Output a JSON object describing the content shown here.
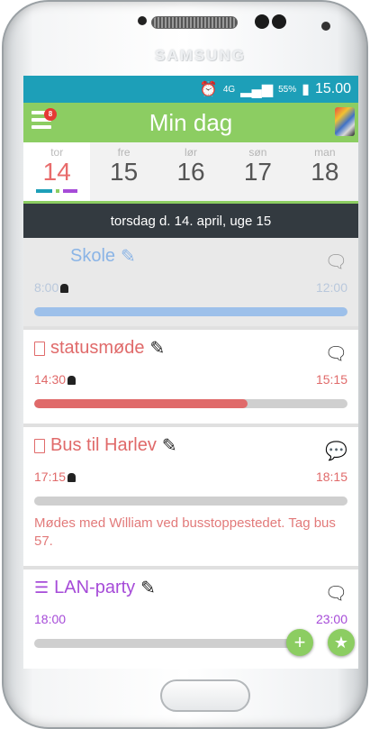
{
  "device": {
    "brand": "SAMSUNG"
  },
  "statusbar": {
    "alarm_icon": "alarm-icon",
    "network": "4G",
    "battery": "55%",
    "time": "15.00"
  },
  "appbar": {
    "title": "Min dag",
    "notification_count": "8"
  },
  "week": {
    "days": [
      {
        "weekday": "tor",
        "date": "14"
      },
      {
        "weekday": "fre",
        "date": "15"
      },
      {
        "weekday": "lør",
        "date": "16"
      },
      {
        "weekday": "søn",
        "date": "17"
      },
      {
        "weekday": "man",
        "date": "18"
      }
    ],
    "active_index": 0,
    "marker_colors": [
      "#1d9fb8",
      "#8ccd62",
      "#a64bd8"
    ]
  },
  "date_header": "torsdag d. 14. april, uge 15",
  "events": [
    {
      "title": "Skole",
      "start": "8:00",
      "end": "12:00",
      "color": "#8ab4e6",
      "progress": 1.0,
      "bar_color": "#9dc0ea",
      "state": "past"
    },
    {
      "title": "statusmøde",
      "start": "14:30",
      "end": "15:15",
      "color": "#e06a6a",
      "progress": 0.68,
      "bar_color": "#e06a6a"
    },
    {
      "title": "Bus til Harlev",
      "start": "17:15",
      "end": "18:15",
      "color": "#e06a6a",
      "progress": 0.0,
      "note": "Mødes med William ved busstoppestedet. Tag bus 57."
    },
    {
      "title": "LAN-party",
      "start": "18:00",
      "end": "23:00",
      "color": "#a64bd8",
      "progress": 0.0
    }
  ],
  "fab": {
    "add_label": "+",
    "favorite_icon": "star-icon"
  }
}
